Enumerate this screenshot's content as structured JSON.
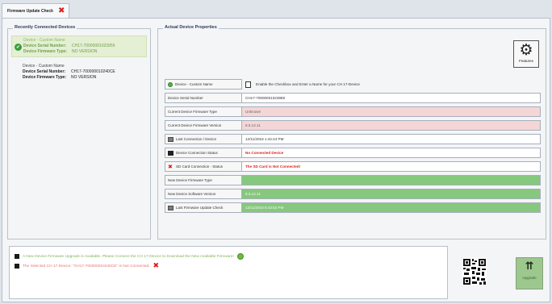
{
  "tab": {
    "title": "Firmware Update Check"
  },
  "recent": {
    "title": "Recently Connected Devices",
    "devices": [
      {
        "name": "Device - Custom Name",
        "serial_key": "Device Serial Number:",
        "serial": "CH17-70000001023959",
        "fw_key": "Device Firmware Type:",
        "fw": "NO VERSION"
      },
      {
        "name": "Device - Custom Name",
        "serial_key": "Device Serial Number:",
        "serial": "CH17-700000010240CE",
        "fw_key": "Device Firmware Type:",
        "fw": "NO VERSION"
      }
    ]
  },
  "actual": {
    "title": "Actual Device Properties",
    "features_label": "Features",
    "rows": [
      {
        "label": "Device - Custom Name",
        "value": "Enable the Checkbox and Enter a Name for your CH 17-Device"
      },
      {
        "label": "Device Serial Number",
        "value": "CH17-70000001023959"
      },
      {
        "label": "Current Device Firmware Type",
        "value": "Unknown"
      },
      {
        "label": "Current Device Firmware Version",
        "value": "8.5.12.11"
      },
      {
        "label": "Last Connection / Device",
        "value": "12/11/2018 1:44:44 PM"
      },
      {
        "label": "Device Connection Status",
        "value": "No Connected Device"
      },
      {
        "label": "SD Card Connection - Status",
        "value": "The SD Card is Not Connected!"
      },
      {
        "label": "New Device Firmware Type",
        "value": ""
      },
      {
        "label": "New Device Software Version",
        "value": "8.5.12.11"
      },
      {
        "label": "Last Firmware Update Check",
        "value": "12/11/2018 6:43:52 PM"
      }
    ]
  },
  "messages": [
    {
      "text": "A New Device Firmware Upgrade is Available. Please Connect the CH 17-Device to Download the New Available Firmware!"
    },
    {
      "text": "The Selected CH 17-Device: \"CH17-700000010240CE\" is Not Connected."
    }
  ],
  "upgrade": {
    "label": "Upgrade"
  },
  "colors": {
    "accent_green": "#86c87d",
    "warning_pink": "#f5d6d6",
    "error_red": "#e42020"
  }
}
